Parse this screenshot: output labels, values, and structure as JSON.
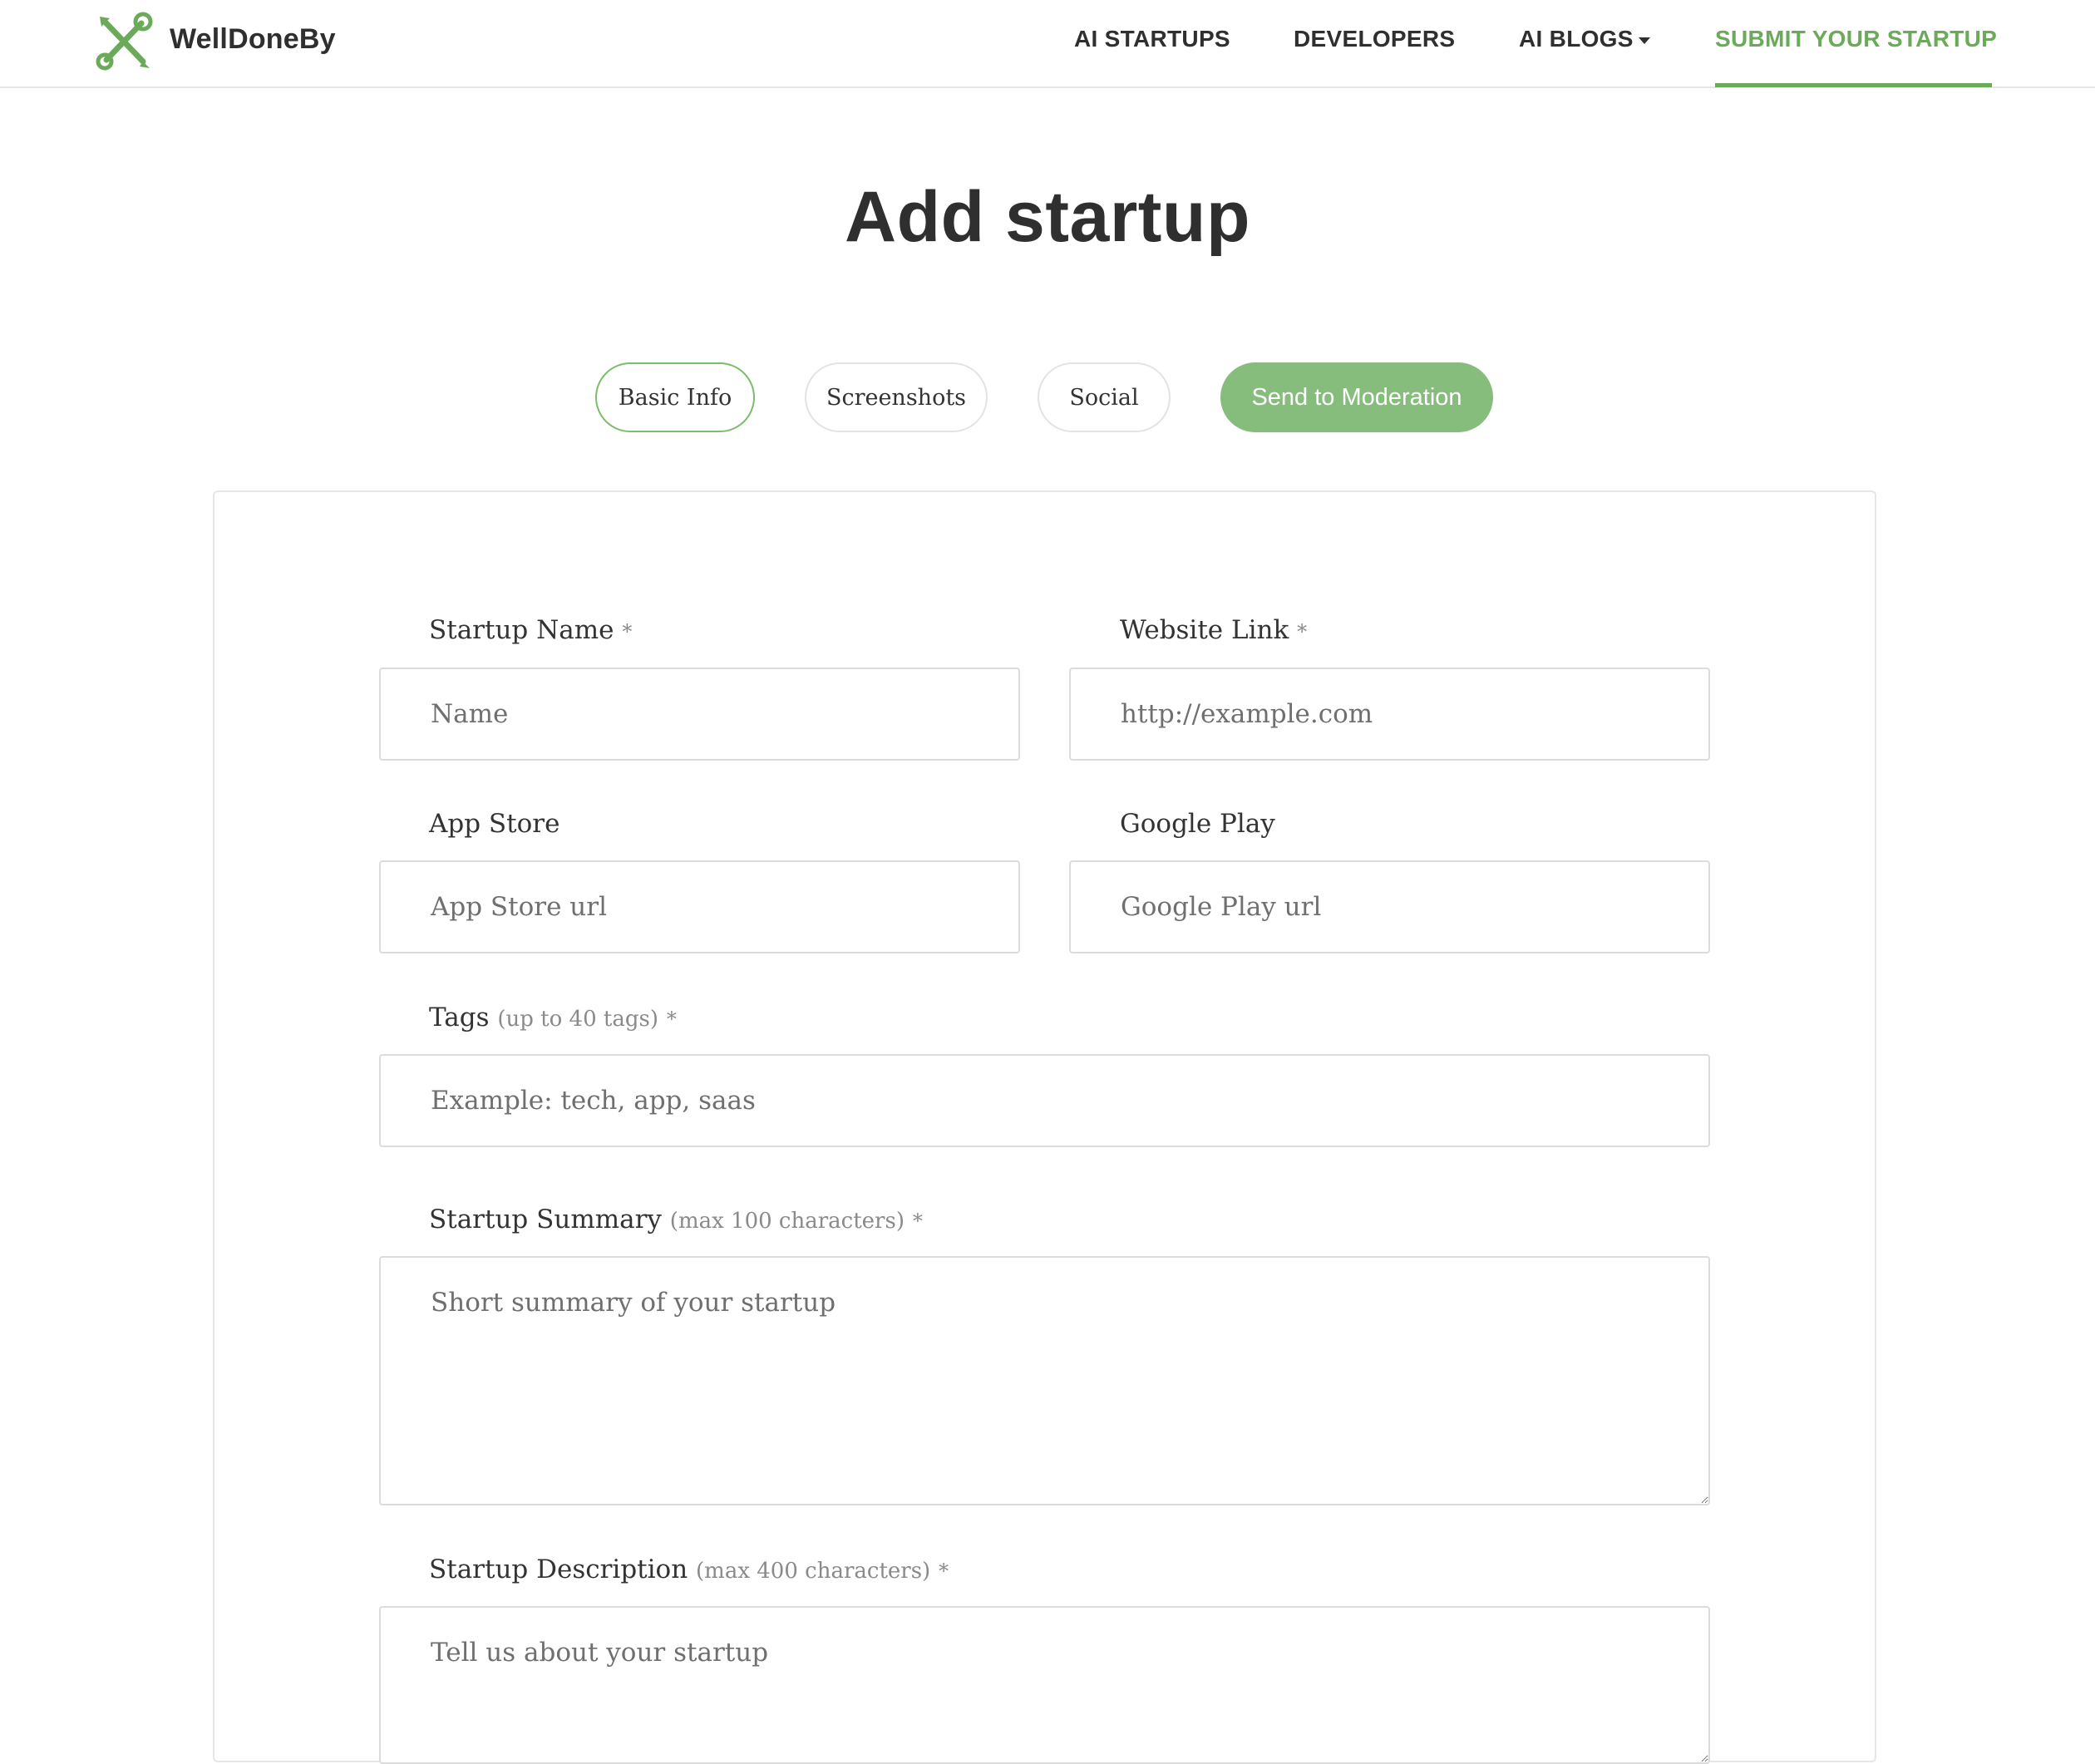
{
  "brand": {
    "name": "WellDoneBy",
    "logo_icon": "wrench-pencil-icon",
    "accent": "#6aaa58"
  },
  "nav": {
    "items": [
      {
        "label": "AI STARTUPS"
      },
      {
        "label": "DEVELOPERS"
      },
      {
        "label": "AI BLOGS",
        "has_dropdown": true
      },
      {
        "label": "SUBMIT YOUR STARTUP",
        "active": true
      }
    ]
  },
  "page": {
    "title": "Add startup"
  },
  "steps": [
    {
      "label": "Basic Info",
      "active": true
    },
    {
      "label": "Screenshots"
    },
    {
      "label": "Social"
    },
    {
      "label": "Send to Moderation",
      "primary": true
    }
  ],
  "form": {
    "startup_name": {
      "label": "Startup Name",
      "required": "*",
      "placeholder": "Name",
      "value": ""
    },
    "website_link": {
      "label": "Website Link",
      "required": "*",
      "placeholder": "http://example.com",
      "value": ""
    },
    "app_store": {
      "label": "App Store",
      "placeholder": "App Store url",
      "value": ""
    },
    "google_play": {
      "label": "Google Play",
      "placeholder": "Google Play url",
      "value": ""
    },
    "tags": {
      "label": "Tags",
      "hint": "(up to 40 tags)",
      "required": "*",
      "placeholder": "Example: tech, app, saas",
      "value": ""
    },
    "summary": {
      "label": "Startup Summary",
      "hint": "(max 100 characters)",
      "required": "*",
      "placeholder": "Short summary of your startup",
      "value": ""
    },
    "description": {
      "label": "Startup Description",
      "hint": "(max 400 characters)",
      "required": "*",
      "placeholder": "Tell us about your startup",
      "value": ""
    }
  }
}
